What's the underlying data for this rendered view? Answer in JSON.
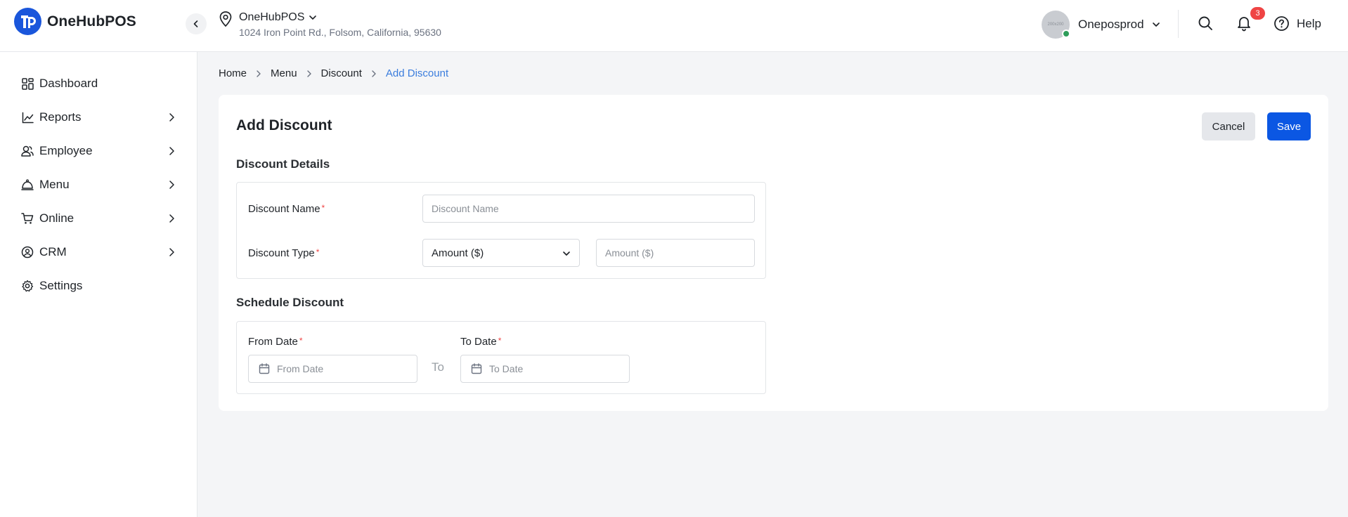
{
  "app": {
    "name": "OneHubPOS",
    "location_name": "OneHubPOS",
    "location_address": "1024 Iron Point Rd., Folsom, California, 95630",
    "user_name": "Oneposprod",
    "avatar_text": "200x200",
    "notification_count": "3",
    "help_label": "Help"
  },
  "sidebar": {
    "items": [
      {
        "label": "Dashboard",
        "icon": "dashboard-icon"
      },
      {
        "label": "Reports",
        "icon": "chart-line-icon"
      },
      {
        "label": "Employee",
        "icon": "users-icon"
      },
      {
        "label": "Menu",
        "icon": "cloche-icon"
      },
      {
        "label": "Online",
        "icon": "cart-icon"
      },
      {
        "label": "CRM",
        "icon": "crm-icon"
      },
      {
        "label": "Settings",
        "icon": "gear-icon"
      }
    ]
  },
  "breadcrumb": [
    "Home",
    "Menu",
    "Discount",
    "Add Discount"
  ],
  "page": {
    "title": "Add Discount",
    "cancel_label": "Cancel",
    "save_label": "Save"
  },
  "discount_details": {
    "section_title": "Discount Details",
    "name_label": "Discount Name",
    "name_placeholder": "Discount Name",
    "type_label": "Discount Type",
    "type_selected": "Amount ($)",
    "amount_placeholder": "Amount ($)",
    "required_mark": "*"
  },
  "schedule": {
    "section_title": "Schedule Discount",
    "from_label": "From Date",
    "from_placeholder": "From Date",
    "to_separator": "To",
    "to_label": "To Date",
    "to_placeholder": "To Date"
  },
  "colors": {
    "accent": "#0b57e3",
    "breadcrumb_active": "#3b7ddd",
    "required": "#ef4444",
    "online_status": "#2e9d5a"
  }
}
